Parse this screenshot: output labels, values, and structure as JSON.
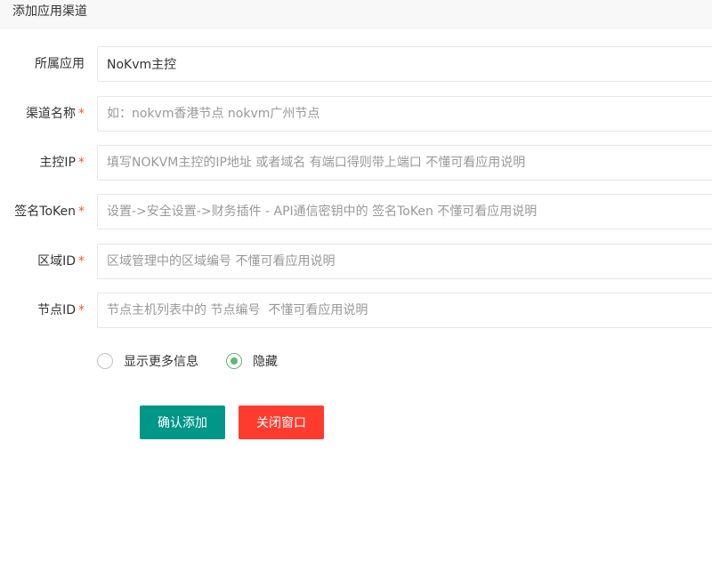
{
  "window": {
    "title": "添加应用渠道"
  },
  "form": {
    "required_marker": "*",
    "fields": [
      {
        "label": "所属应用",
        "required": false,
        "value": "NoKvm主控",
        "placeholder": ""
      },
      {
        "label": "渠道名称",
        "required": true,
        "value": "",
        "placeholder": "如：nokvm香港节点 nokvm广州节点"
      },
      {
        "label": "主控IP",
        "required": true,
        "value": "",
        "placeholder": "填写NOKVM主控的IP地址 或者域名 有端口得则带上端口 不懂可看应用说明"
      },
      {
        "label": "签名ToKen",
        "required": true,
        "value": "",
        "placeholder": "设置->安全设置->财务插件 - API通信密钥中的 签名ToKen 不懂可看应用说明"
      },
      {
        "label": "区域ID",
        "required": true,
        "value": "",
        "placeholder": "区域管理中的区域编号 不懂可看应用说明"
      },
      {
        "label": "节点ID",
        "required": true,
        "value": "",
        "placeholder": "节点主机列表中的 节点编号  不懂可看应用说明"
      }
    ],
    "radio_options": [
      {
        "label": "显示更多信息",
        "checked": false
      },
      {
        "label": "隐藏",
        "checked": true
      }
    ]
  },
  "buttons": {
    "confirm_label": "确认添加",
    "close_label": "关闭窗口"
  },
  "colors": {
    "primary": "#009688",
    "danger": "#ff3b30",
    "radio_checked": "#5fb878",
    "required": "#ff5722"
  }
}
